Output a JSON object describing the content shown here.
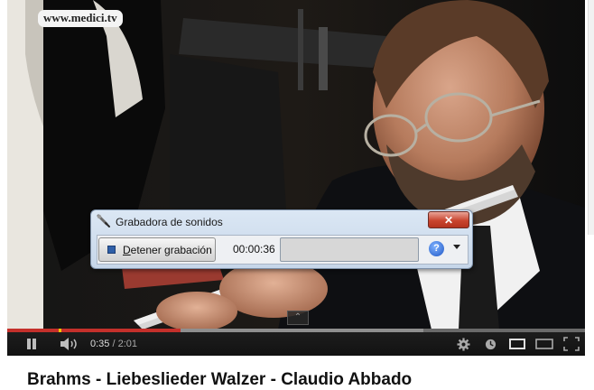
{
  "video": {
    "watermark": "www.medici.tv",
    "progress": {
      "played_fraction": 0.3,
      "loaded_fraction": 0.72
    },
    "current_time": "0:35",
    "time_separator": " / ",
    "duration": "2:01",
    "title": "Brahms - Liebeslieder Walzer - Claudio Abbado"
  },
  "controls": {
    "play_pause_icon": "pause-icon",
    "volume_icon": "volume-icon",
    "settings_icon": "gear-icon",
    "watch_later_icon": "clock-icon",
    "small_player_icon": "small-player-icon",
    "large_player_icon": "large-player-icon",
    "fullscreen_icon": "fullscreen-icon"
  },
  "recorder": {
    "window_title": "Grabadora de sonidos",
    "stop_button": {
      "mnemonic": "D",
      "rest": "etener grabación"
    },
    "elapsed": "00:00:36",
    "level_fraction": 0.0,
    "help_label": "?"
  },
  "colors": {
    "played": "#c4302b",
    "controls_bg": "#1b1b1b",
    "close_button": "#c9452f"
  }
}
